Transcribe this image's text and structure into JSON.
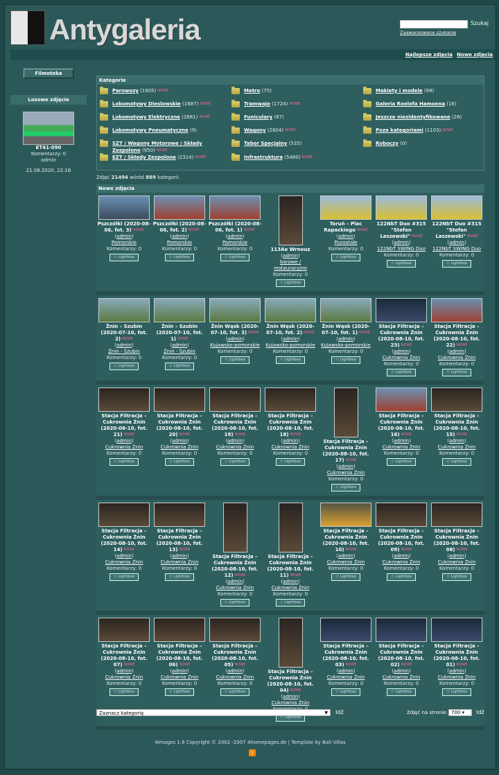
{
  "header": {
    "logo_text": "Antygaleria",
    "search_button": "Szukaj",
    "advanced_search": "Zaawansowane szukanie",
    "search_placeholder": ""
  },
  "topnav": {
    "best": "Najlepsze zdjęcia",
    "newest": "Nowe zdjęcia"
  },
  "sidebar": {
    "filmoteka": "Filmoteka",
    "random_title": "Losowe zdjęcie",
    "random_name": "ET41-090",
    "random_comments": "Komentarzy: 0",
    "random_user": "admin",
    "random_date": "21.08.2020, 22:16"
  },
  "categories_title": "Kategorie",
  "new_badge": "NOWE",
  "categories": [
    {
      "name": "Parowozy",
      "count": "(1905)",
      "new": true
    },
    {
      "name": "Metro",
      "count": "(75)",
      "new": false
    },
    {
      "name": "Makiety i modele",
      "count": "(98)",
      "new": false
    },
    {
      "name": "Lokomotywy Dieslowskie",
      "count": "(1687)",
      "new": true
    },
    {
      "name": "Tramwaje",
      "count": "(1724)",
      "new": true
    },
    {
      "name": "Galeria Roelofa Hamoena",
      "count": "(16)",
      "new": false
    },
    {
      "name": "Lokomotywy Elektryczne",
      "count": "(2681)",
      "new": true
    },
    {
      "name": "Funiculary",
      "count": "(87)",
      "new": false
    },
    {
      "name": "Jeszcze niezidentyfikowane",
      "count": "(26)",
      "new": false
    },
    {
      "name": "Lokomotywy Pneumatyczne",
      "count": "(9)",
      "new": false
    },
    {
      "name": "Wagony",
      "count": "(2804)",
      "new": true
    },
    {
      "name": "Poza kategoriami",
      "count": "(1103)",
      "new": true
    },
    {
      "name": "SZT / Wagony Motorowe / Składy Zespolone",
      "count": "(950)",
      "new": true
    },
    {
      "name": "Tabor Specjalny",
      "count": "(535)",
      "new": false
    },
    {
      "name": "Roboczy",
      "count": "(0)",
      "new": false
    },
    {
      "name": "EZT / Składy Zespolone",
      "count": "(2314)",
      "new": true
    },
    {
      "name": "Infrastruktura",
      "count": "(5480)",
      "new": true
    },
    {
      "name": "",
      "count": "",
      "new": false
    }
  ],
  "stats": {
    "prefix": "Zdjęć",
    "photos": "21494",
    "mid": "wśród",
    "cats": "889",
    "suffix": "kategorii."
  },
  "new_photos_title": "Nowe zdjęcia",
  "user": "admin",
  "comments": "Komentarzy: 0",
  "lightbox": "Lightbox",
  "rows": [
    [
      {
        "title": "Pszczółki (2020-08-06, fot. 3)",
        "cat": "Pomorskie",
        "style": "",
        "new": true
      },
      {
        "title": "Pszczółki (2020-08-06, fot. 2)",
        "cat": "Pomorskie",
        "style": "red",
        "new": true
      },
      {
        "title": "Pszczółki (2020-08-06, fot. 1)",
        "cat": "Pomorskie",
        "style": "red",
        "new": true
      },
      {
        "title": "113Ae Wrnouz",
        "cat": "barowe / restauracyjne",
        "style": "v dark",
        "new": false
      },
      {
        "title": "Toruń – Plac Rapackiego",
        "cat": "Pozostałe",
        "style": "yellow",
        "new": true
      },
      {
        "title": "122NbT Duo #315 \"Stefan Laszewski\"",
        "cat": "122NbT SWING Duo",
        "style": "yellow",
        "new": true
      },
      {
        "title": "122NbT Duo #315 \"Stefan Laszewski\"",
        "cat": "122NbT SWING Duo",
        "style": "yellow",
        "new": true
      }
    ],
    [
      {
        "title": "Żnin – Szubin (2020-07-10, fot. 2)",
        "cat": "Żnin - Szubin",
        "style": "green",
        "new": true
      },
      {
        "title": "Żnin – Szubin (2020-07-10, fot. 1)",
        "cat": "Żnin - Szubin",
        "style": "green",
        "new": true
      },
      {
        "title": "Żnin Wąsk (2020-07-10, fot. 3)",
        "cat": "Kujawsko-pomorskie",
        "style": "green",
        "new": true
      },
      {
        "title": "Żnin Wąsk (2020-07-10, fot. 2)",
        "cat": "Kujawsko-pomorskie",
        "style": "green",
        "new": true
      },
      {
        "title": "Żnin Wąsk (2020-07-10, fot. 1)",
        "cat": "Kujawsko-pomorskie",
        "style": "green",
        "new": true
      },
      {
        "title": "Stacja Filtracja – Cukrownia Żnin (2020-08-10, fot. 23)",
        "cat": "Cukrownia Żnin",
        "style": "night",
        "new": true
      },
      {
        "title": "Stacja Filtracja – Cukrownia Żnin (2020-08-10, fot. 22)",
        "cat": "Cukrownia Żnin",
        "style": "red",
        "new": true
      }
    ],
    [
      {
        "title": "Stacja Filtracja – Cukrownia Żnin (2020-08-10, fot. 21)",
        "cat": "Cukrownia Żnin",
        "style": "dark",
        "new": true
      },
      {
        "title": "Stacja Filtracja – Cukrownia Żnin (2020-08-10, fot. 20)",
        "cat": "Cukrownia Żnin",
        "style": "dark",
        "new": true
      },
      {
        "title": "Stacja Filtracja – Cukrownia Żnin (2020-08-10, fot. 19)",
        "cat": "Cukrownia Żnin",
        "style": "dark",
        "new": true
      },
      {
        "title": "Stacja Filtracja – Cukrownia Żnin (2020-08-10, fot. 18)",
        "cat": "Cukrownia Żnin",
        "style": "dark",
        "new": true
      },
      {
        "title": "Stacja Filtracja – Cukrownia Żnin (2020-08-10, fot. 17)",
        "cat": "Cukrownia Żnin",
        "style": "v dark",
        "new": true
      },
      {
        "title": "Stacja Filtracja – Cukrownia Żnin (2020-08-10, fot. 16)",
        "cat": "Cukrownia Żnin",
        "style": "red",
        "new": true
      },
      {
        "title": "Stacja Filtracja – Cukrownia Żnin (2020-08-10, fot. 15)",
        "cat": "Cukrownia Żnin",
        "style": "dark",
        "new": true
      }
    ],
    [
      {
        "title": "Stacja Filtracja – Cukrownia Żnin (2020-08-10, fot. 14)",
        "cat": "Cukrownia Żnin",
        "style": "dark",
        "new": true
      },
      {
        "title": "Stacja Filtracja – Cukrownia Żnin (2020-08-10, fot. 13)",
        "cat": "Cukrownia Żnin",
        "style": "dark",
        "new": true
      },
      {
        "title": "Stacja Filtracja – Cukrownia Żnin (2020-08-10, fot. 12)",
        "cat": "Cukrownia Żnin",
        "style": "v dark",
        "new": true
      },
      {
        "title": "Stacja Filtracja – Cukrownia Żnin (2020-08-10, fot. 11)",
        "cat": "Cukrownia Żnin",
        "style": "v dark",
        "new": true
      },
      {
        "title": "Stacja Filtracja – Cukrownia Żnin (2020-08-10, fot. 10)",
        "cat": "Cukrownia Żnin",
        "style": "beer",
        "new": true
      },
      {
        "title": "Stacja Filtracja – Cukrownia Żnin (2020-08-10, fot. 09)",
        "cat": "Cukrownia Żnin",
        "style": "dark",
        "new": true
      },
      {
        "title": "Stacja Filtracja – Cukrownia Żnin (2020-08-10, fot. 08)",
        "cat": "Cukrownia Żnin",
        "style": "dark",
        "new": true
      }
    ],
    [
      {
        "title": "Stacja Filtracja – Cukrownia Żnin (2020-08-10, fot. 07)",
        "cat": "Cukrownia Żnin",
        "style": "dark",
        "new": true
      },
      {
        "title": "Stacja Filtracja – Cukrownia Żnin (2020-08-10, fot. 06)",
        "cat": "Cukrownia Żnin",
        "style": "dark",
        "new": true
      },
      {
        "title": "Stacja Filtracja – Cukrownia Żnin (2020-08-10, fot. 05)",
        "cat": "Cukrownia Żnin",
        "style": "dark",
        "new": true
      },
      {
        "title": "Stacja Filtracja – Cukrownia Żnin (2020-08-10, fot. 04)",
        "cat": "Cukrownia Żnin",
        "style": "v dark",
        "new": true
      },
      {
        "title": "Stacja Filtracja – Cukrownia Żnin (2020-08-10, fot. 03)",
        "cat": "Cukrownia Żnin",
        "style": "night",
        "new": true
      },
      {
        "title": "Stacja Filtracja – Cukrownia Żnin (2020-08-10, fot. 02)",
        "cat": "Cukrownia Żnin",
        "style": "night",
        "new": true
      },
      {
        "title": "Stacja Filtracja – Cukrownia Żnin (2020-08-10, fot. 01)",
        "cat": "Cukrownia Żnin",
        "style": "night",
        "new": true
      }
    ]
  ],
  "bottom": {
    "category_select": "Zaznacz kategorię",
    "go": "Idź",
    "per_page_label": "Zdjęć na stronie:",
    "per_page_value": "700"
  },
  "footer": {
    "text": "4images 1.8   Copyright © 2002 -2007 4homepages.de | Template by Bali Villas"
  }
}
